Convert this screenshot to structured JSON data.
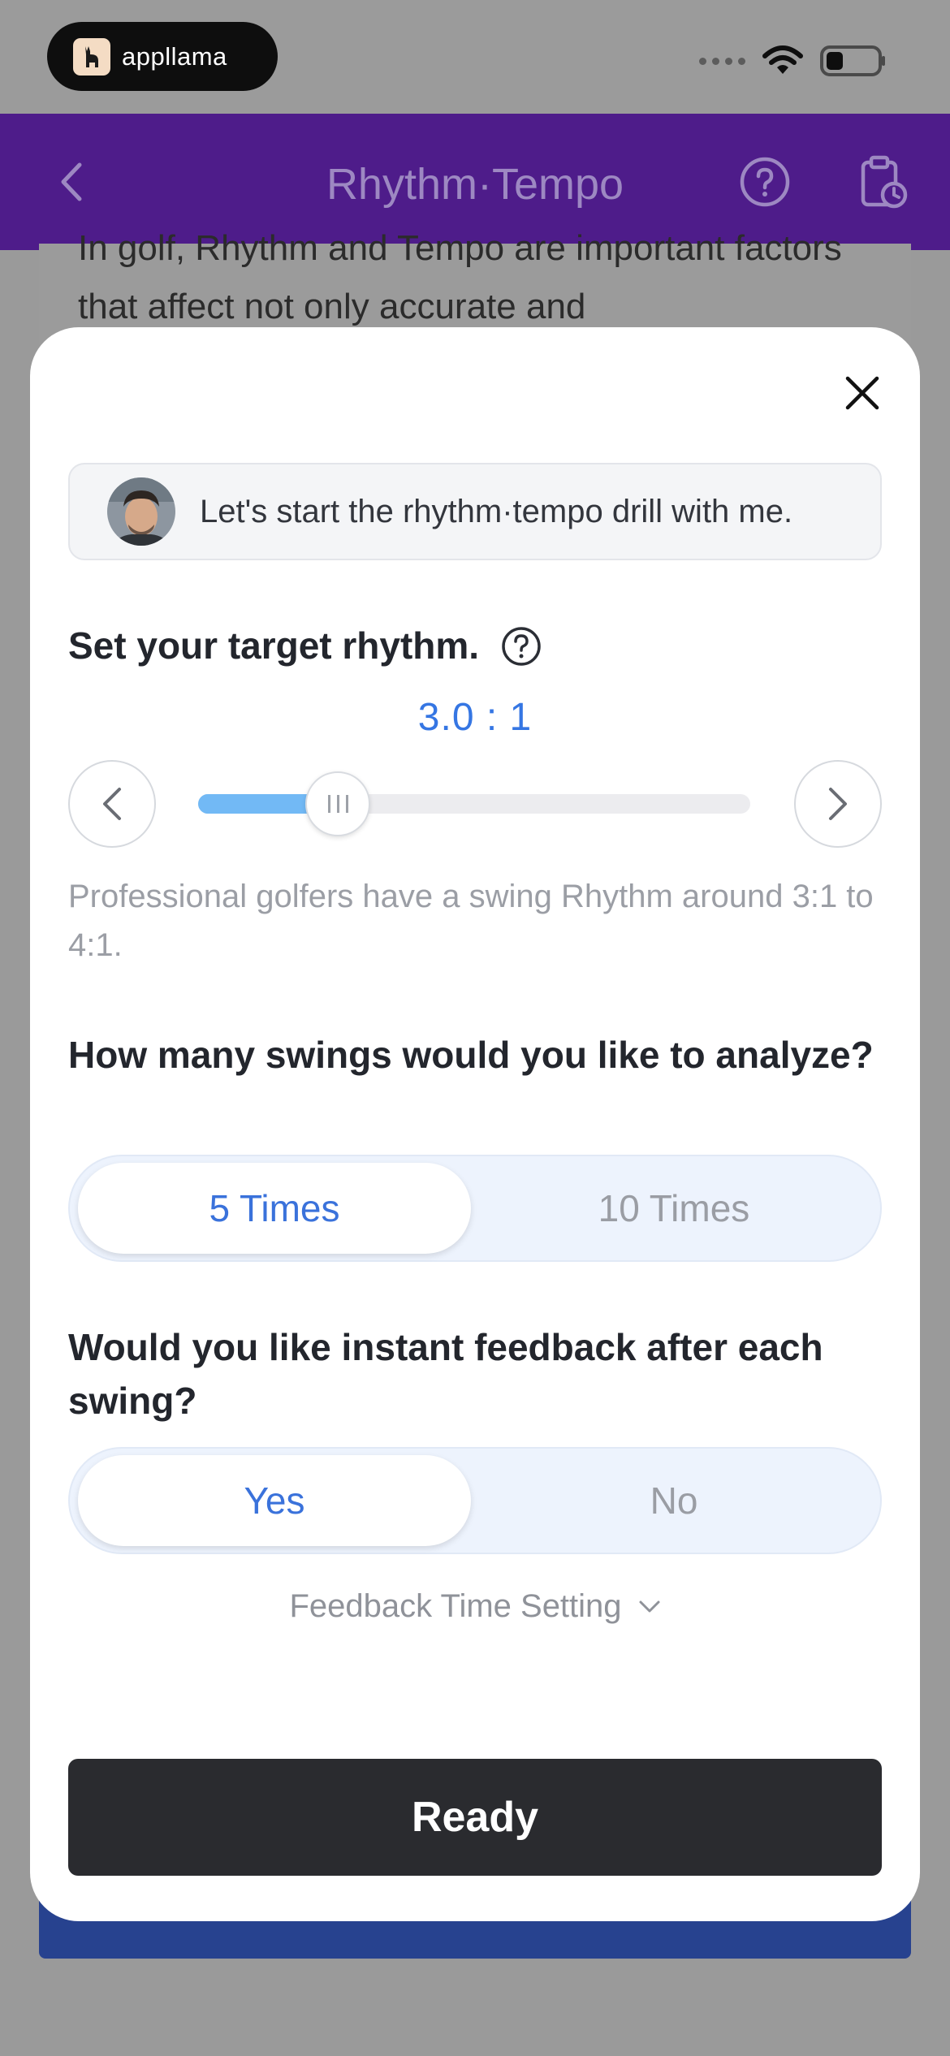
{
  "status_bar": {
    "brand_name": "appllama"
  },
  "header": {
    "title": "Rhythm·Tempo",
    "back_icon": "chevron-left-icon",
    "help_icon": "question-circle-icon",
    "history_icon": "clipboard-clock-icon"
  },
  "background": {
    "paragraph": "In golf, Rhythm and Tempo are important factors that affect not only accurate and"
  },
  "modal": {
    "coach_message": "Let's start the rhythm·tempo drill with me.",
    "rhythm": {
      "title": "Set your target rhythm.",
      "value": "3.0 : 1",
      "slider_fraction": 0.18,
      "hint": "Professional golfers have a swing Rhythm around 3:1 to 4:1."
    },
    "swings": {
      "title": "How many swings would you like to analyze?",
      "options": [
        "5 Times",
        "10 Times"
      ],
      "selected": "5 Times"
    },
    "feedback": {
      "title": "Would you like instant feedback after each swing?",
      "options": [
        "Yes",
        "No"
      ],
      "selected": "Yes"
    },
    "feedback_time_setting": "Feedback Time Setting",
    "ready_label": "Ready"
  },
  "colors": {
    "header_bg": "#4e1c8a",
    "accent_blue": "#3576e3",
    "slider_fill": "#72b9f5",
    "ready_bg": "#2a2b2f"
  }
}
